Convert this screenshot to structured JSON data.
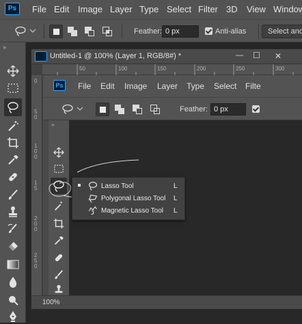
{
  "app": {
    "logo_text": "Ps",
    "menu": [
      "File",
      "Edit",
      "Image",
      "Layer",
      "Type",
      "Select",
      "Filter",
      "3D",
      "View",
      "Window"
    ]
  },
  "options_bar": {
    "feather_label": "Feather:",
    "feather_value": "0 px",
    "antialias_label": "Anti-alias",
    "antialias_checked": true,
    "select_mask_label": "Select and"
  },
  "document": {
    "tab_title": "Untitled-1 @ 100% (Layer 1, RGB/8#) *",
    "zoom": "100%",
    "minimize_glyph": "—",
    "restore_glyph": "☐",
    "close_glyph": "✕"
  },
  "nested_app": {
    "logo_text": "Ps",
    "menu": [
      "File",
      "Edit",
      "Image",
      "Layer",
      "Type",
      "Select",
      "Filte"
    ],
    "feather_label": "Feather:",
    "feather_value": "0 px"
  },
  "ruler": {
    "top": [
      "0",
      "50",
      "100",
      "150",
      "200",
      "250",
      "300"
    ],
    "left": [
      "0",
      "5 0",
      "1 0 0",
      "1 5",
      "2 0 0",
      "2 5 0"
    ]
  },
  "flyout": {
    "items": [
      {
        "label": "Lasso Tool",
        "shortcut": "L",
        "active": true
      },
      {
        "label": "Polygonal Lasso Tool",
        "shortcut": "L",
        "active": false
      },
      {
        "label": "Magnetic Lasso Tool",
        "shortcut": "L",
        "active": false
      }
    ]
  },
  "colors": {
    "accent": "#31a8ff",
    "panel": "#535353",
    "canvas": "#262626"
  }
}
